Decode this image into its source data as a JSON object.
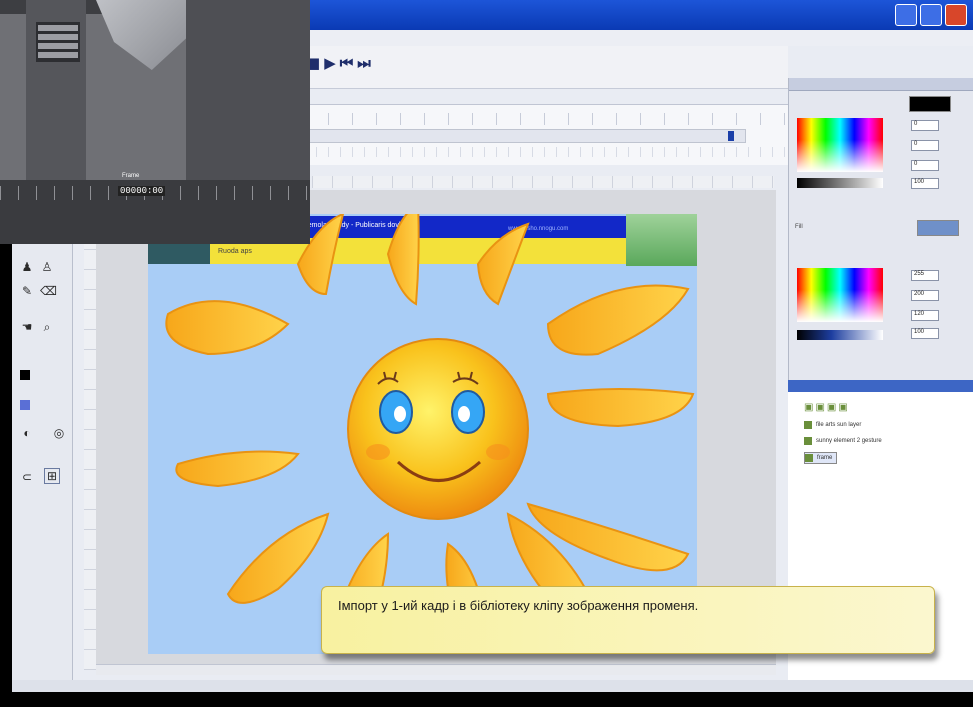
{
  "player": {
    "controls": [
      "■",
      "▶",
      "⏮",
      "⏭"
    ]
  },
  "overlay_inset": {
    "label": "Frame",
    "value": "00000:00"
  },
  "stage": {
    "banner_title": "anemolar Study - Publicaris dovbletu",
    "banner_link": "www.tosho.nnogu.com",
    "banner_caption": "Ruoda aps"
  },
  "library": {
    "items": [
      {
        "label": "file arts sun layer"
      },
      {
        "label": "sunny element 2 gesture"
      },
      {
        "label": "frame"
      }
    ]
  },
  "color_panel": {
    "fields": [
      "0",
      "0",
      "0",
      "100"
    ],
    "fields2": [
      "255",
      "200",
      "120",
      "100"
    ],
    "label": "Fill"
  },
  "subtitle": {
    "text": "Імпорт у 1-ий кадр і в бібліотеку кліпу зображення променя."
  },
  "colors": {
    "title_bar": "#0a3ab4",
    "stage_bg": "#a9cdf6",
    "sun_core": "#f6b21a",
    "subtitle_bg": "#f8f1a0"
  }
}
